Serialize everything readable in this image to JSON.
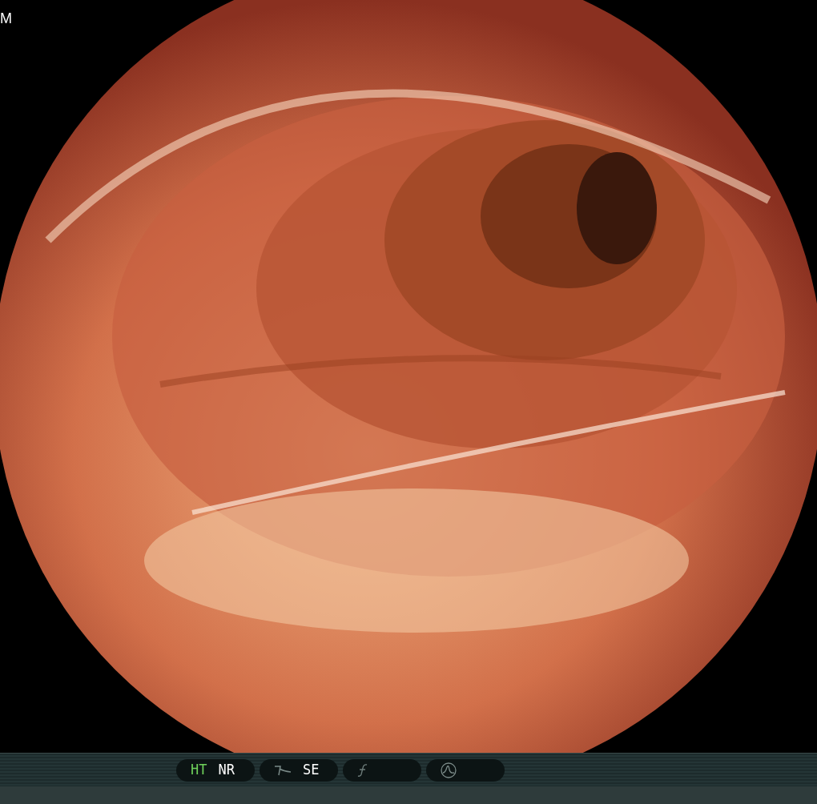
{
  "video": {
    "kind": "picture",
    "corner_text": "M"
  },
  "status_bar": {
    "groups": [
      {
        "items": [
          {
            "kind": "text",
            "label": "HT",
            "active": true
          },
          {
            "kind": "text",
            "label": "NR",
            "active": false
          }
        ]
      },
      {
        "items": [
          {
            "kind": "curve"
          },
          {
            "kind": "text",
            "label": "SE",
            "active": false
          }
        ]
      },
      {
        "items": [
          {
            "kind": "function"
          }
        ]
      },
      {
        "items": [
          {
            "kind": "waveform"
          }
        ]
      }
    ]
  }
}
